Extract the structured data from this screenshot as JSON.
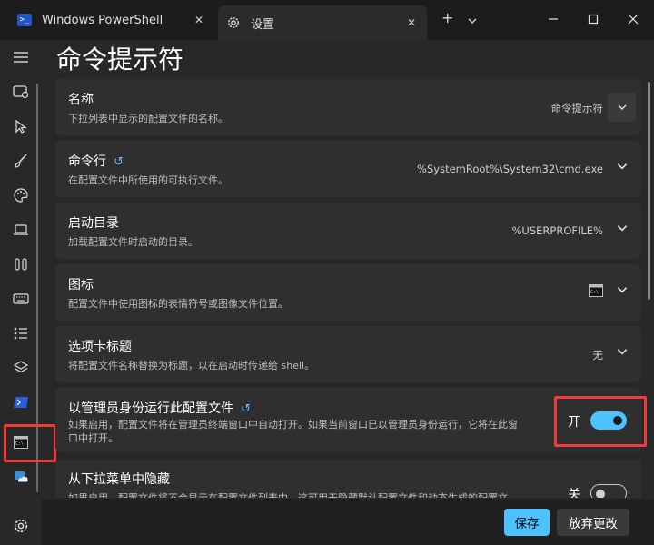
{
  "tabs": [
    {
      "title": "Windows PowerShell",
      "icon": "powershell-icon"
    },
    {
      "title": "设置",
      "icon": "gear-icon"
    }
  ],
  "page": {
    "title": "命令提示符"
  },
  "settings": {
    "name": {
      "title": "名称",
      "description": "下拉列表中显示的配置文件的名称。",
      "value": "命令提示符"
    },
    "command_line": {
      "title": "命令行",
      "description": "在配置文件中所使用的可执行文件。",
      "value": "%SystemRoot%\\System32\\cmd.exe"
    },
    "start_dir": {
      "title": "启动目录",
      "description": "加载配置文件时启动的目录。",
      "value": "%USERPROFILE%"
    },
    "icon": {
      "title": "图标",
      "description": "配置文件中使用图标的表情符号或图像文件位置。",
      "value_icon": "terminal-icon"
    },
    "tab_title": {
      "title": "选项卡标题",
      "description": "将配置文件名称替换为标题，以在启动时传递给 shell。",
      "value": "无"
    },
    "run_as_admin": {
      "title": "以管理员身份运行此配置文件",
      "description_line1": "如果启用，配置文件将在管理员终端窗口中自动打开。如果当前窗口已以管理员身份运行，它将在此窗",
      "description_line2": "口中打开。",
      "toggle_label": "开",
      "toggle_state": "on"
    },
    "hide_dropdown": {
      "title": "从下拉菜单中隐藏",
      "description": "如果启用，配置文件将不会显示在配置文件列表中。这可用于隐藏默认配置文件和动态生成的配置文",
      "toggle_label": "关",
      "toggle_state": "off"
    }
  },
  "footer": {
    "save_label": "保存",
    "discard_label": "放弃更改"
  },
  "colors": {
    "accent": "#4cc2ff",
    "highlight": "#ee3b3b"
  }
}
